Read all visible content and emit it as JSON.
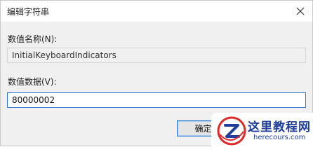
{
  "dialog": {
    "title": "编辑字符串",
    "close_icon": "close-icon"
  },
  "value_name": {
    "label": "数值名称(N):",
    "value": "InitialKeyboardIndicators"
  },
  "value_data": {
    "label": "数值数据(V):",
    "value": "80000002"
  },
  "buttons": {
    "ok_label": "确定"
  },
  "watermark": {
    "title": "这里教程网",
    "url": "herecours.com",
    "logo_icon": "z-logo-icon",
    "colors": {
      "red": "#e02a2a",
      "blue": "#1f3e9c"
    }
  },
  "colors": {
    "focus_border": "#2a7bd3",
    "client_bg": "#f0f0f0"
  }
}
